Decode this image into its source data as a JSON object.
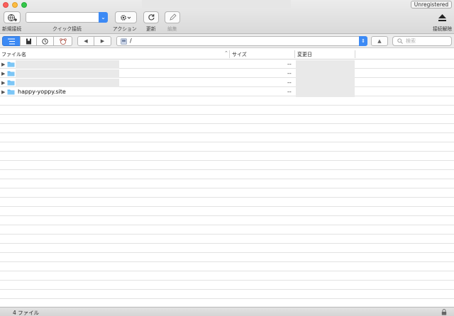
{
  "window": {
    "badge": "Unregistered"
  },
  "toolbar": {
    "new_connection_label": "新規接続",
    "quick_connect": {
      "label": "クイック接続",
      "value": ""
    },
    "action_label": "アクション",
    "refresh_label": "更新",
    "edit_label": "編集",
    "disconnect_label": "接続解除"
  },
  "pathbar": {
    "path": "/",
    "search_placeholder": "検索"
  },
  "columns": {
    "filename": "ファイル名",
    "size": "サイズ",
    "modified": "変更日"
  },
  "files": [
    {
      "name": "",
      "size": "--",
      "icon": "folder-icon"
    },
    {
      "name": "",
      "size": "--",
      "icon": "folder-icon"
    },
    {
      "name": "",
      "size": "--",
      "icon": "folder-icon"
    },
    {
      "name": "happy-yoppy.site",
      "size": "--",
      "icon": "folder-icon"
    }
  ],
  "status": {
    "file_count": "4 ファイル"
  },
  "colors": {
    "accent": "#3c8af5",
    "folder": "#5bb4f2"
  }
}
